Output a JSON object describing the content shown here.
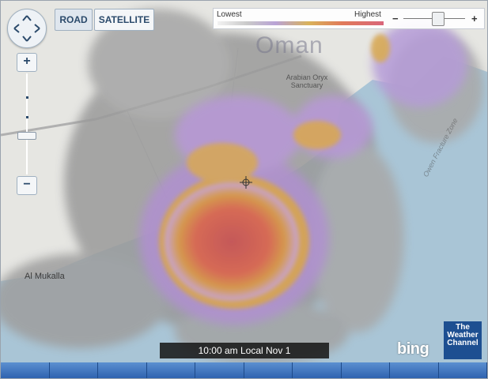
{
  "map": {
    "place_labels": {
      "country": "Oman",
      "sanctuary": "Arabian Oryx Sanctuary",
      "city": "Al Mukalla",
      "ocean": "Owen Fracture Zone"
    }
  },
  "controls": {
    "pan_icon": "pan-arrows",
    "zoom_in": "+",
    "zoom_out": "−",
    "zoom_level": 0.72
  },
  "map_type": {
    "road_label": "ROAD",
    "satellite_label": "SATELLITE",
    "selected": "ROAD"
  },
  "legend": {
    "low_label": "Lowest",
    "high_label": "Highest",
    "minus": "−",
    "plus": "+",
    "opacity_level": 0.55,
    "colors": [
      "#f2f2f2",
      "#c9c9c9",
      "#b9a3d6",
      "#d9b25a",
      "#e07a5a",
      "#d9667a"
    ]
  },
  "timestamp": "10:00 am Local Nov 1",
  "branding": {
    "bing": "bing",
    "twc_line1": "The",
    "twc_line2": "Weather",
    "twc_line3": "Channel",
    "twc_color": "#1d4f91"
  },
  "colors": {
    "water": "#a9c5d6",
    "land": "#e8e8e4",
    "accent": "#2f63b0"
  }
}
